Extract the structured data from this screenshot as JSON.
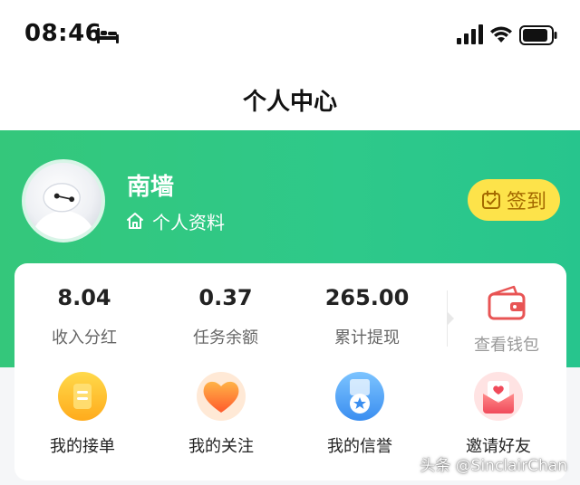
{
  "status_bar": {
    "time": "08:46"
  },
  "nav": {
    "title": "个人中心"
  },
  "profile": {
    "username": "南墙",
    "profile_link_label": "个人资料",
    "checkin_label": "签到"
  },
  "stats": [
    {
      "value": "8.04",
      "label": "收入分红"
    },
    {
      "value": "0.37",
      "label": "任务余额"
    },
    {
      "value": "265.00",
      "label": "累计提现"
    }
  ],
  "wallet": {
    "label": "查看钱包"
  },
  "menu": [
    {
      "label": "我的接单",
      "icon": "order-icon"
    },
    {
      "label": "我的关注",
      "icon": "heart-icon"
    },
    {
      "label": "我的信誉",
      "icon": "medal-icon"
    },
    {
      "label": "邀请好友",
      "icon": "invite-envelope-icon"
    }
  ],
  "watermark": "头条 @SinclairChan",
  "colors": {
    "brand_green": "#2ec98a",
    "checkin_yellow": "#fde34a",
    "wallet_red": "#e85454"
  }
}
